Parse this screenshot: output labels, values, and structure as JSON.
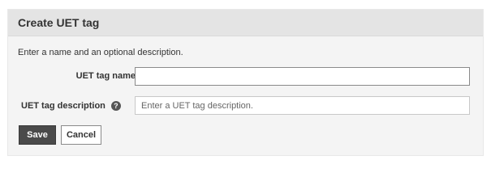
{
  "panel": {
    "title": "Create UET tag",
    "intro": "Enter a name and an optional description."
  },
  "form": {
    "name_label": "UET tag name",
    "name_value": "",
    "description_label": "UET tag description",
    "help_icon_glyph": "?",
    "description_value": "",
    "description_placeholder": "Enter a UET tag description."
  },
  "buttons": {
    "save_label": "Save",
    "cancel_label": "Cancel"
  },
  "icons": {
    "help": "help-icon"
  },
  "colors": {
    "save_button_bg": "#4a4a4a",
    "header_bg": "#e4e4e4",
    "panel_bg": "#f4f4f4"
  }
}
